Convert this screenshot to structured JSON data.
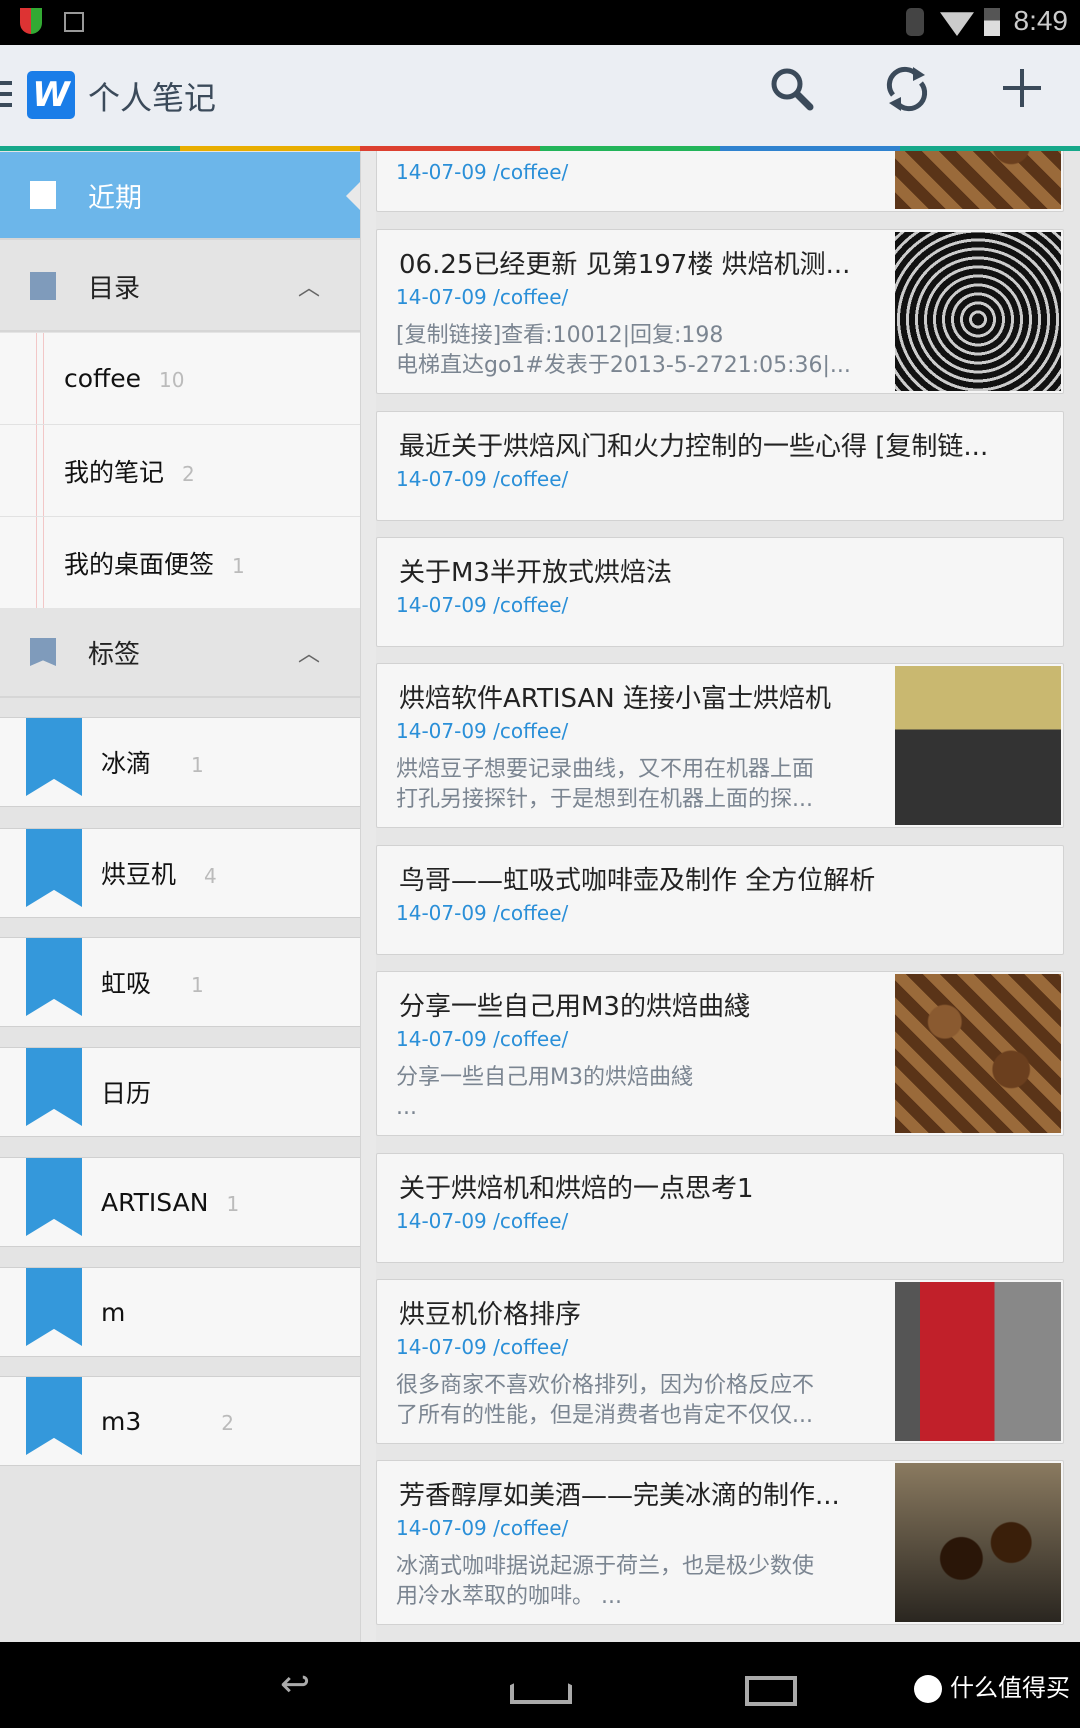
{
  "status_bar": {
    "time": "8:49"
  },
  "app_bar": {
    "logo_letter": "W",
    "title": "个人笔记"
  },
  "colors": {
    "accent": "#6cb6ea",
    "strip": [
      "#16a88a",
      "#e8ad00",
      "#dc4030",
      "#22b45a",
      "#2f82cf",
      "#16a88a"
    ],
    "tag": "#3498db",
    "meta": "#2a8fd8"
  },
  "sidebar": {
    "recent": "近期",
    "folders_header": "目录",
    "folders": [
      {
        "name": "coffee",
        "count": "10"
      },
      {
        "name": "我的笔记",
        "count": "2"
      },
      {
        "name": "我的桌面便签",
        "count": "1"
      }
    ],
    "tags_header": "标签",
    "tags": [
      {
        "name": "冰滴",
        "count": "1"
      },
      {
        "name": "烘豆机",
        "count": "4"
      },
      {
        "name": "虹吸",
        "count": "1"
      },
      {
        "name": "日历",
        "count": ""
      },
      {
        "name": "ARTISAN",
        "count": "1"
      },
      {
        "name": "m",
        "count": ""
      },
      {
        "name": "m3",
        "count": "2"
      }
    ]
  },
  "notes": [
    {
      "title": "",
      "meta": "14-07-09  /coffee/",
      "snippet": "",
      "image": "coffee-beans"
    },
    {
      "title": "06.25已经更新 见第197楼 烘焙机测...",
      "meta": "14-07-09  /coffee/",
      "snippet": "[复制链接]查看:10012|回复:198\n电梯直达go1#发表于2013-5-2721:05:36|...",
      "image": "roaster-fan"
    },
    {
      "title": "最近关于烘焙风门和火力控制的一些心得  [复制链...",
      "meta": "14-07-09  /coffee/",
      "snippet": ""
    },
    {
      "title": "关于M3半开放式烘焙法",
      "meta": "14-07-09  /coffee/",
      "snippet": ""
    },
    {
      "title": "烘焙软件ARTISAN 连接小富士烘焙机",
      "meta": "14-07-09  /coffee/",
      "snippet": "烘焙豆子想要记录曲线，又不用在机器上面\n打孔另接探针，于是想到在机器上面的探...",
      "image": "roaster-machine"
    },
    {
      "title": "鸟哥——虹吸式咖啡壶及制作 全方位解析",
      "meta": "14-07-09  /coffee/",
      "snippet": ""
    },
    {
      "title": "分享一些自己用M3的烘焙曲綫",
      "meta": "14-07-09  /coffee/",
      "snippet": "分享一些自己用M3的烘焙曲綫\n...",
      "image": "coffee-beans"
    },
    {
      "title": "关于烘焙机和烘焙的一点思考1",
      "meta": "14-07-09  /coffee/",
      "snippet": ""
    },
    {
      "title": "烘豆机价格排序",
      "meta": "14-07-09  /coffee/",
      "snippet": "很多商家不喜欢价格排列，因为价格反应不\n了所有的性能，但是消费者也肯定不仅仅...",
      "image": "red-roaster"
    },
    {
      "title": "芳香醇厚如美酒——完美冰滴的制作...",
      "meta": "14-07-09  /coffee/",
      "snippet": "冰滴式咖啡据说起源于荷兰，也是极少数使\n用冷水萃取的咖啡。 ...",
      "image": "cold-drip-glasses"
    }
  ],
  "watermark": "什么值得买"
}
